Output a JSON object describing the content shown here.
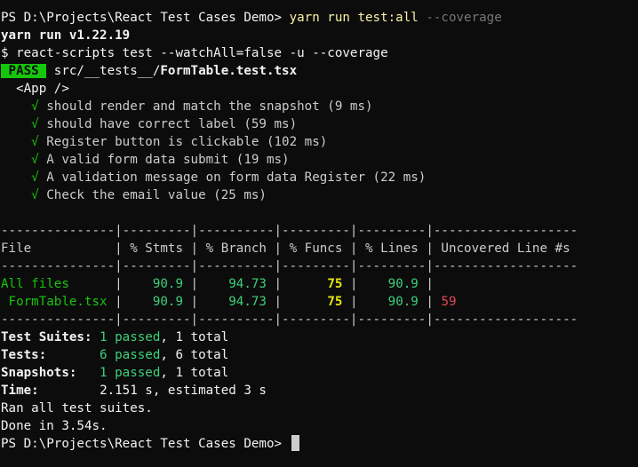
{
  "terminal": {
    "prompt1": "PS D:\\Projects\\React Test Cases Demo> ",
    "cmd1": "yarn run test:all",
    "cmd1_flag": " --coverage",
    "yarn_version": "yarn run v1.22.19",
    "exec_line": "$ react-scripts test --watchAll=false -u --coverage",
    "pass_badge": " PASS ",
    "test_dir": " src/__tests__/",
    "test_file": "FormTable.test.tsx",
    "suite_name": "  <App />",
    "check": "√",
    "tests": [
      {
        "name": "should render and match the snapshot (9 ms)"
      },
      {
        "name": "should have correct label (59 ms)"
      },
      {
        "name": "Register button is clickable (102 ms)"
      },
      {
        "name": "A valid form data submit (19 ms)"
      },
      {
        "name": "A validation message on form data Register (22 ms)"
      },
      {
        "name": "Check the email value (25 ms)"
      }
    ],
    "table": {
      "sep": "---------------|---------|----------|---------|---------|-------------------",
      "header": "File           | % Stmts | % Branch | % Funcs | % Lines | Uncovered Line #s ",
      "rows": [
        {
          "file": "All files     ",
          "stmts": "90.9",
          "branch": "94.73",
          "funcs": "75",
          "lines": "90.9",
          "uncovered": ""
        },
        {
          "file": " FormTable.tsx",
          "stmts": "90.9",
          "branch": "94.73",
          "funcs": "75",
          "lines": "90.9",
          "uncovered": "59"
        }
      ]
    },
    "summary": {
      "suites_label": "Test Suites:",
      "suites_passed": "1 passed",
      "suites_total": ", 1 total",
      "tests_label": "Tests:",
      "tests_passed": "6 passed",
      "tests_total": ", 6 total",
      "snap_label": "Snapshots:",
      "snap_passed": "1 passed",
      "snap_total": ", 1 total",
      "time_label": "Time:",
      "time_value": "2.151 s, estimated 3 s"
    },
    "ran_all": "Ran all test suites.",
    "done": "Done in 3.54s.",
    "prompt2": "PS D:\\Projects\\React Test Cases Demo> "
  }
}
